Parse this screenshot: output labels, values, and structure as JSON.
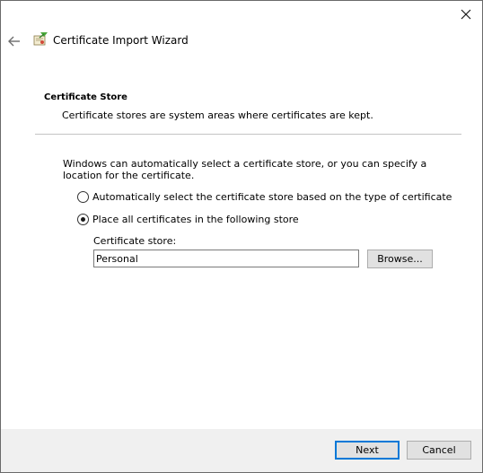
{
  "window": {
    "title": "Certificate Import Wizard"
  },
  "page": {
    "heading": "Certificate Store",
    "description": "Certificate stores are system areas where certificates are kept.",
    "intro": "Windows can automatically select a certificate store, or you can specify a location for the certificate."
  },
  "options": {
    "auto_label": "Automatically select the certificate store based on the type of certificate",
    "manual_label": "Place all certificates in the following store",
    "selected": "manual"
  },
  "store": {
    "label": "Certificate store:",
    "value": "Personal",
    "browse_label": "Browse..."
  },
  "footer": {
    "next_label": "Next",
    "cancel_label": "Cancel"
  },
  "colors": {
    "accent": "#0078d7",
    "footer_bg": "#f0f0f0",
    "button_bg": "#e1e1e1"
  },
  "icons": {
    "close": "close-icon",
    "back": "back-arrow-icon",
    "wizard": "certificate-wizard-icon"
  }
}
